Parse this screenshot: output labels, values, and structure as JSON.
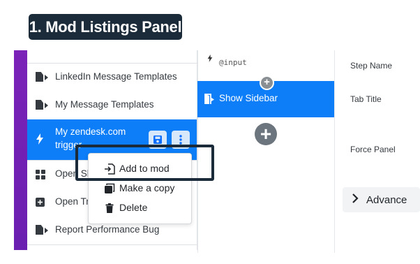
{
  "banner": {
    "title": "1. Mod Listings Panel"
  },
  "sidebar": {
    "items": [
      {
        "label": "LinkedIn Message Templates",
        "icon": "file-play-icon"
      },
      {
        "label": "My Message Templates",
        "icon": "file-play-icon"
      },
      {
        "label_line1": "My zendesk.com",
        "label_line2": "trigger",
        "icon": "bolt-icon"
      },
      {
        "label": "Open Sl",
        "icon": "grid-icon"
      },
      {
        "label": "Open Tr",
        "icon": "plus-square-icon"
      },
      {
        "label": "Report Performance Bug",
        "icon": "file-play-icon"
      }
    ]
  },
  "middle": {
    "input_label": "@input",
    "show_sidebar_label": "Show Sidebar"
  },
  "right": {
    "fields": [
      "Step Name",
      "Tab Title",
      "Force Panel"
    ],
    "advanced_label": "Advance"
  },
  "menu": {
    "items": [
      {
        "label": "Add to mod",
        "icon": "add-to-mod-icon"
      },
      {
        "label": "Make a copy",
        "icon": "copy-icon"
      },
      {
        "label": "Delete",
        "icon": "trash-icon"
      }
    ]
  },
  "colors": {
    "accent": "#0d7ef7",
    "banner_bg": "#1b2b3a",
    "purple_strip": "#7b22b8"
  }
}
